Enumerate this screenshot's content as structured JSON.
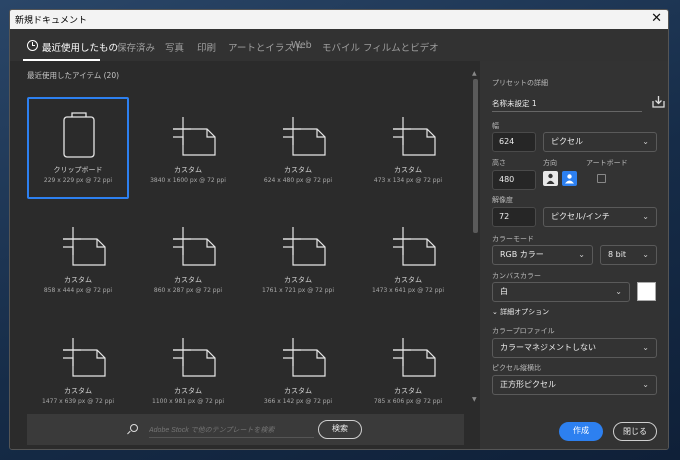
{
  "window": {
    "title": "新規ドキュメント",
    "close": "✕"
  },
  "tabs": [
    {
      "label": "最近使用したもの",
      "active": true
    },
    {
      "label": "保存済み"
    },
    {
      "label": "写真"
    },
    {
      "label": "印刷"
    },
    {
      "label": "アートとイラスト"
    },
    {
      "label": "Web"
    },
    {
      "label": "モバイル"
    },
    {
      "label": "フィルムとビデオ"
    }
  ],
  "recent": {
    "heading": "最近使用したアイテム (20)",
    "items": [
      {
        "name": "クリップボード",
        "size": "229 x 229 px @ 72 ppi",
        "icon": "clipboard-icon",
        "selected": true
      },
      {
        "name": "カスタム",
        "size": "3840 x 1600 px @ 72 ppi",
        "icon": "document-preset-icon"
      },
      {
        "name": "カスタム",
        "size": "624 x 480 px @ 72 ppi",
        "icon": "document-preset-icon"
      },
      {
        "name": "カスタム",
        "size": "473 x 134 px @ 72 ppi",
        "icon": "document-preset-icon"
      },
      {
        "name": "カスタム",
        "size": "858 x 444 px @ 72 ppi",
        "icon": "document-preset-icon"
      },
      {
        "name": "カスタム",
        "size": "860 x 287 px @ 72 ppi",
        "icon": "document-preset-icon"
      },
      {
        "name": "カスタム",
        "size": "1761 x 721 px @ 72 ppi",
        "icon": "document-preset-icon"
      },
      {
        "name": "カスタム",
        "size": "1473 x 641 px @ 72 ppi",
        "icon": "document-preset-icon"
      },
      {
        "name": "カスタム",
        "size": "1477 x 639 px @ 72 ppi",
        "icon": "document-preset-icon"
      },
      {
        "name": "カスタム",
        "size": "1100 x 981 px @ 72 ppi",
        "icon": "document-preset-icon"
      },
      {
        "name": "カスタム",
        "size": "366 x 142 px @ 72 ppi",
        "icon": "document-preset-icon"
      },
      {
        "name": "カスタム",
        "size": "785 x 606 px @ 72 ppi",
        "icon": "document-preset-icon"
      }
    ]
  },
  "search": {
    "placeholder": "Adobe Stock で他のテンプレートを検索",
    "button": "検索"
  },
  "preset": {
    "heading": "プリセットの詳細",
    "name": "名称未設定 1",
    "width_label": "幅",
    "width": "624",
    "width_unit": "ピクセル",
    "height_label": "高さ",
    "height": "480",
    "orientation_label": "方向",
    "artboard_label": "アートボード",
    "resolution_label": "解像度",
    "resolution": "72",
    "resolution_unit": "ピクセル/インチ",
    "color_mode_label": "カラーモード",
    "color_mode": "RGB カラー",
    "bit_depth": "8 bit",
    "canvas_color_label": "カンバスカラー",
    "canvas_color": "白",
    "canvas_swatch": "#ffffff",
    "advanced_label": "詳細オプション",
    "profile_label": "カラープロファイル",
    "profile": "カラーマネジメントしない",
    "pixel_aspect_label": "ピクセル縦横比",
    "pixel_aspect": "正方形ピクセル"
  },
  "actions": {
    "create": "作成",
    "close": "閉じる"
  },
  "colors": {
    "accent": "#2d80f0",
    "panel": "#2b2b2b",
    "right_panel": "#333333"
  }
}
